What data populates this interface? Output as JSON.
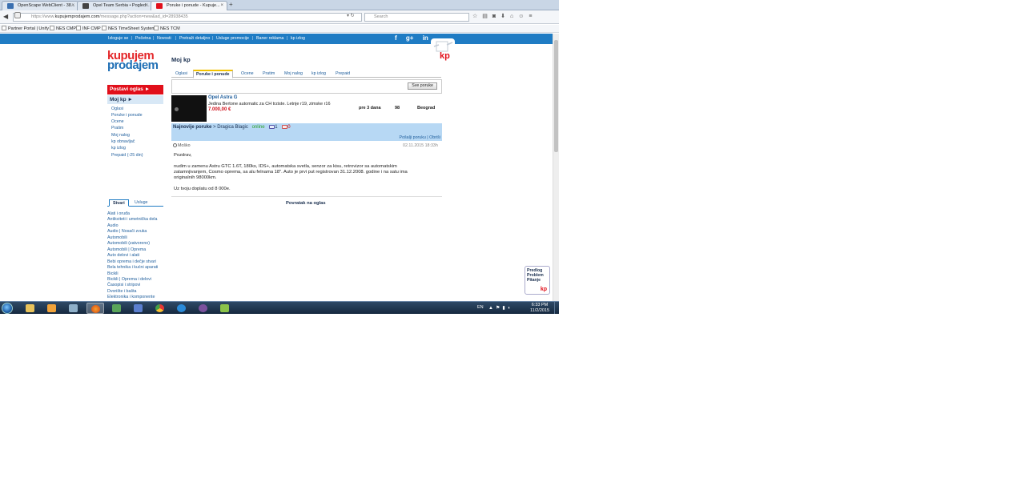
{
  "browser": {
    "tabs": [
      {
        "label": "OpenScape WebClient - 38...",
        "active": false,
        "icon": "openscape-icon",
        "color": "#3a6fb0"
      },
      {
        "label": "Opel Team Serbia • Pogled...",
        "active": false,
        "icon": "forum-icon",
        "color": "#444444"
      },
      {
        "label": "Poruke i ponude - Kupuje...",
        "active": true,
        "icon": "kp-icon",
        "color": "#e10f1a"
      }
    ],
    "new_tab_glyph": "+",
    "tab_close_glyph": "×",
    "url_prefix": "https://www.",
    "url_domain": "kupujemprodajem.com",
    "url_path": "/message.php?action=new&ad_id=28938435",
    "search_placeholder": "Search",
    "bookmarks": [
      "Partner Portal | Unify",
      "NES CMP",
      "INF CMP",
      "NES TimeSheet System",
      "NES TCM"
    ]
  },
  "site": {
    "topnav": [
      "Izloguje se",
      "Početna",
      "Novosti",
      "Pretraži detaljno",
      "Usluge promocije",
      "Baner reklama",
      "kp izlog"
    ],
    "social": [
      "f",
      "g+",
      "in"
    ],
    "logo_line1": "kupujem",
    "logo_line2": "prodajem",
    "post_ad": "Postavi oglas ►",
    "my_kp": "Moj kp ►",
    "my_kp_links": [
      "Oglasi",
      "Poruke i ponude",
      "Ocene",
      "Pratim",
      "Moj nalog",
      "kp obnavljač",
      "kp izlog",
      "Prepaid (-25 din)"
    ],
    "left_tabs": [
      "Stvari",
      "Usluge"
    ],
    "categories": [
      "Alati i oruđa",
      "Antikviteti i umetnička dela",
      "Audio",
      "Audio | Nosači zvuka",
      "Automobili",
      "Automobili (zatvoreno)",
      "Automobili | Oprema",
      "Auto delovi i alati",
      "Bebi oprema i dečje stvari",
      "Bela tehnika i kućni aparati",
      "Bicikli",
      "Bicikli | Oprema i delovi",
      "Časopisi i stripovi",
      "Dvorište i bašta",
      "Elektronika i komponente",
      "Firme",
      "Foto",
      "Građevinarstvo",
      "Igračke i igre",
      "Industrijska oprema",
      "Knjige"
    ],
    "feedback_lines": [
      "Predlog",
      "Problem",
      "Pitanje"
    ],
    "feedback_logo": "kp"
  },
  "main": {
    "title": "Moj kp",
    "tabs": [
      {
        "label": "Oglasi",
        "active": false
      },
      {
        "label": "Poruke i ponude",
        "active": true
      },
      {
        "label": "Ocene",
        "active": false
      },
      {
        "label": "Pratim",
        "active": false
      },
      {
        "label": "Moj nalog",
        "active": false
      },
      {
        "label": "kp izlog",
        "active": false
      },
      {
        "label": "Prepaid",
        "active": false
      }
    ],
    "all_messages_button": "Sve poruke",
    "ad": {
      "title": "Opel Astra G",
      "description": "Jedina Bertone automatic za CH trziste. Letnje r19, zimske r16",
      "price": "7.000,00 €",
      "age": "pre 3 dana",
      "views": "98",
      "city": "Beograd"
    },
    "latest": {
      "label": "Najnovije poruke",
      "separator": " > ",
      "sender": "Dragica Blagic",
      "status": "online",
      "thumbs_up": "1",
      "thumbs_down": "0",
      "send_link": "Pošalji poruku",
      "delete_link": "Obriši"
    },
    "message": {
      "author": "Moško",
      "date": "02.11.2015 18:33h",
      "lines": [
        "Pozdrav,",
        "nudim u zamenu Astru GTC 1.6T, 180ks, IDS+, automatska svetla, senzor za kisu, retrovizor sa automatskim",
        "zatamnjivanjem, Cosmo oprema, sa alu felnama 18\". Auto je prvi put registrovan 31.12.2008. godine i na satu ima",
        "originalnih 98000km.",
        "Uz tvoju doplatu od 8 000e."
      ]
    },
    "back_link": "Povratak na oglas"
  },
  "taskbar": {
    "apps": [
      "explorer-icon",
      "outlook-icon",
      "network-icon",
      "firefox-icon",
      "tools-icon",
      "remote-desktop-icon",
      "chrome-icon",
      "ie-icon",
      "viber-icon",
      "vmware-icon"
    ],
    "language": "EN",
    "time": "6:33 PM",
    "date": "11/2/2015"
  },
  "colors": {
    "brand_blue": "#1f7cc4",
    "brand_red": "#e10f1a",
    "accent_yellow": "#f2c200"
  }
}
